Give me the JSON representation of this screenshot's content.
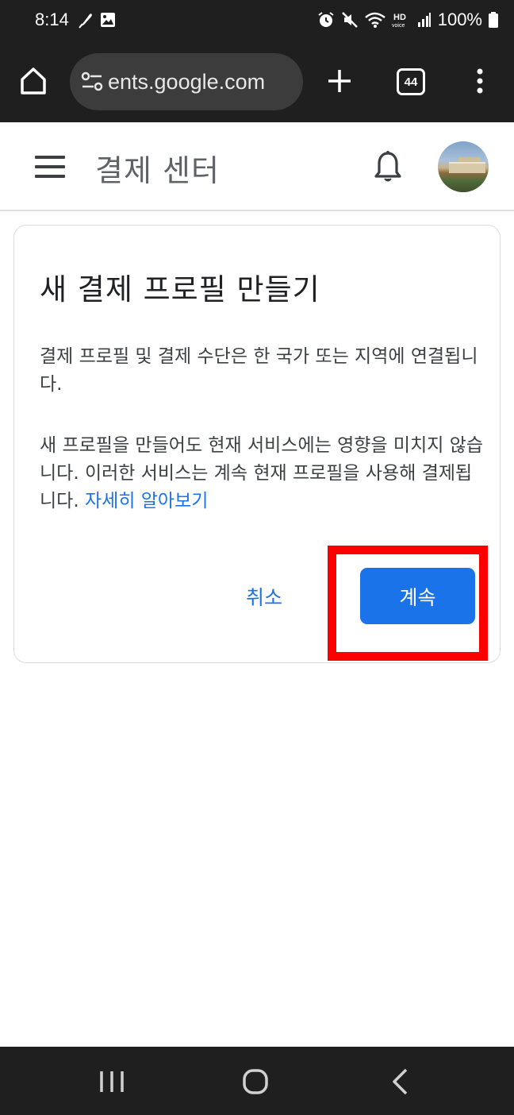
{
  "status_bar": {
    "time": "8:14",
    "battery": "100%",
    "left_icons": [
      "feather-icon",
      "image-icon"
    ],
    "right_icons": [
      "alarm-icon",
      "mute-icon",
      "wifi-icon",
      "hd-voice-icon",
      "signal-icon",
      "battery-icon"
    ]
  },
  "browser": {
    "url": "ents.google.com",
    "tab_count": "44",
    "icons": [
      "home-icon",
      "site-info-icon",
      "new-tab-icon",
      "tab-switcher-icon",
      "more-vert-icon"
    ]
  },
  "app_header": {
    "title": "결제 센터",
    "icons": [
      "menu-icon",
      "bell-icon",
      "avatar"
    ]
  },
  "dialog": {
    "title": "새 결제 프로필 만들기",
    "paragraph1": "결제 프로필 및 결제 수단은 한 국가 또는 지역에 연결됩니다.",
    "paragraph2": "새 프로필을 만들어도 현재 서비스에는 영향을 미치지 않습니다. 이러한 서비스는 계속 현재 프로필을 사용해 결제됩니다.",
    "learn_more": "자세히 알아보기",
    "cancel_label": "취소",
    "continue_label": "계속"
  },
  "colors": {
    "accent": "#1a73e8",
    "highlight": "#ff0000",
    "system_bar": "#1f1f1f"
  },
  "nav_bar": {
    "icons": [
      "recents-icon",
      "home-circle-icon",
      "back-icon"
    ]
  }
}
